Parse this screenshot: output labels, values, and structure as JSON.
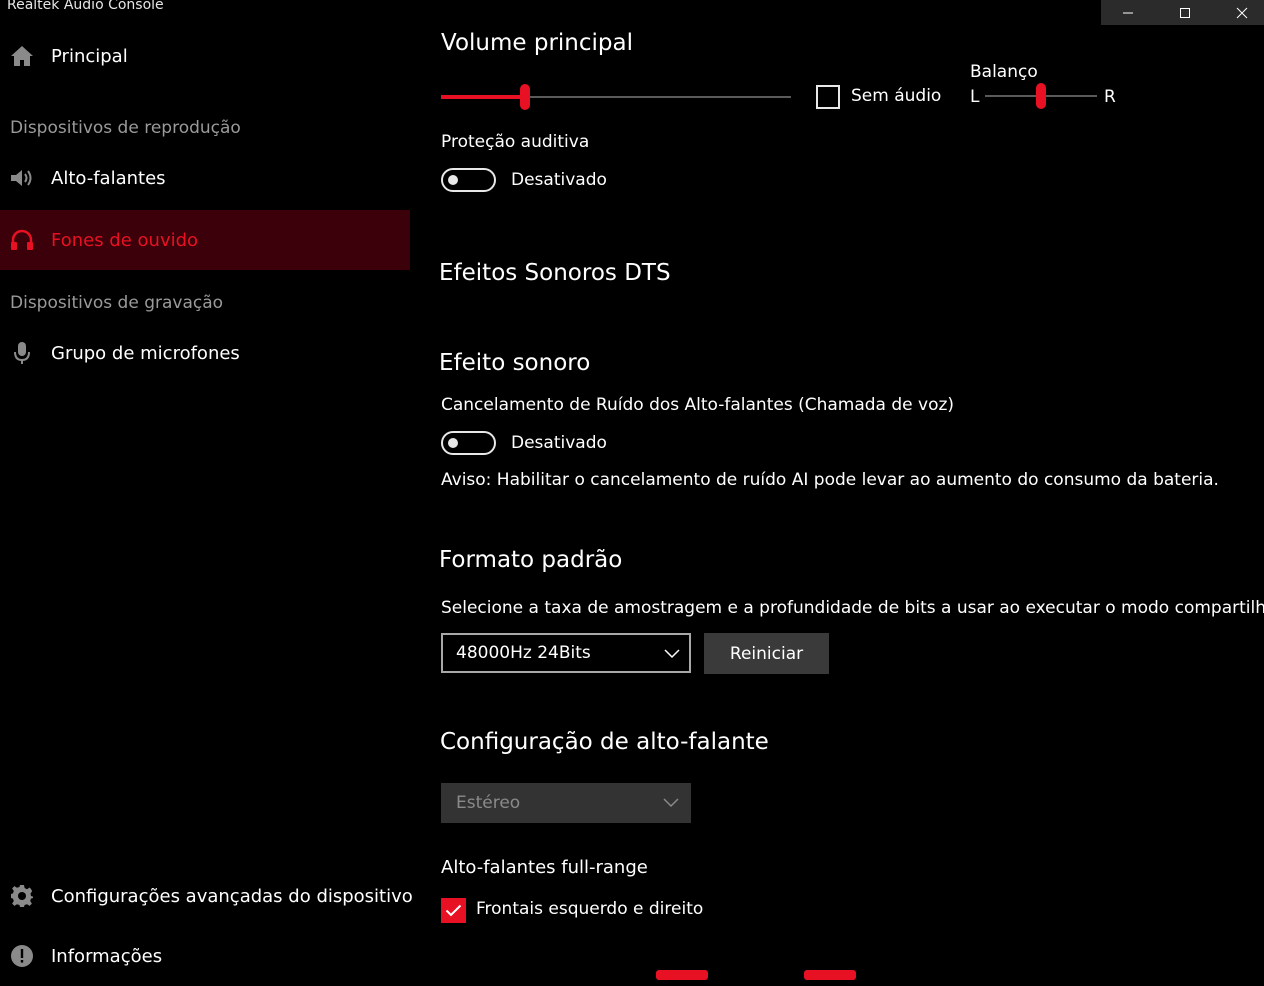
{
  "window": {
    "title": "Realtek Audio Console"
  },
  "sidebar": {
    "home_label": "Principal",
    "playback_section": "Dispositivos de reprodução",
    "playback_items": [
      {
        "label": "Alto-falantes"
      },
      {
        "label": "Fones de ouvido",
        "active": true
      }
    ],
    "recording_section": "Dispositivos de gravação",
    "recording_items": [
      {
        "label": "Grupo de microfones"
      }
    ],
    "advanced_label": "Configurações avançadas do dispositivo",
    "info_label": "Informações"
  },
  "volume": {
    "title": "Volume principal",
    "level": 0.24,
    "mute_label": "Sem áudio",
    "mute_checked": false,
    "balance_label": "Balanço",
    "balance_left": "L",
    "balance_right": "R",
    "balance_level": 0.5
  },
  "hearing": {
    "label": "Proteção auditiva",
    "state": "Desativado"
  },
  "dts": {
    "title": "Efeitos Sonoros DTS"
  },
  "effect": {
    "title": "Efeito sonoro",
    "noise_label": "Cancelamento de Ruído dos Alto-falantes (Chamada de voz)",
    "state": "Desativado",
    "warning": "Aviso: Habilitar o cancelamento de ruído AI pode levar ao aumento do consumo da bateria."
  },
  "format": {
    "title": "Formato padrão",
    "description": "Selecione a taxa de amostragem e a profundidade de bits a usar ao executar o modo compartilhado",
    "selected": "48000Hz 24Bits",
    "reset_label": "Reiniciar"
  },
  "speaker_config": {
    "title": "Configuração de alto-falante",
    "selected": "Estéreo",
    "fullrange_label": "Alto-falantes full-range",
    "front_label": "Frontais esquerdo e direito",
    "front_checked": true
  },
  "colors": {
    "accent": "#e81123",
    "active_bg": "#3b0009",
    "track": "#5a5a5a"
  }
}
